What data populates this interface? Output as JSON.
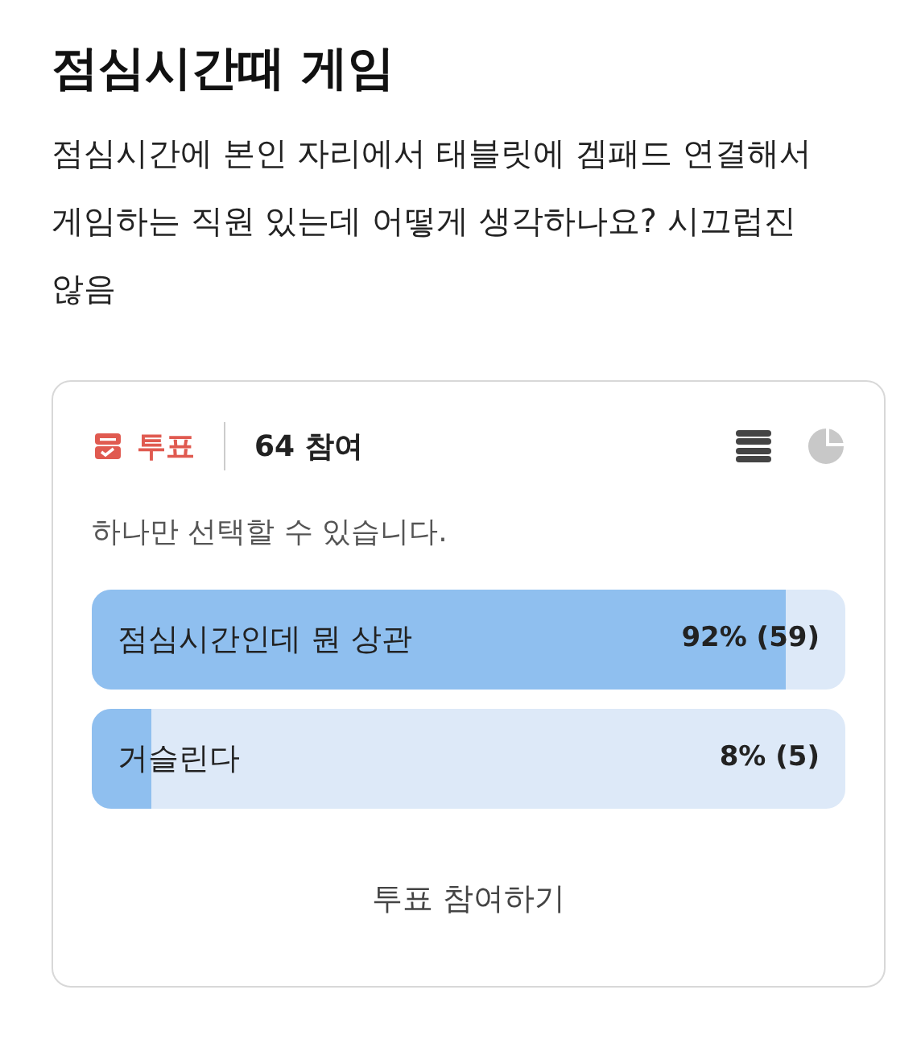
{
  "post": {
    "title": "점심시간때 게임",
    "body": "점심시간에 본인 자리에서 태블릿에 겜패드 연결해서 게임하는 직원 있는데 어떻게 생각하나요? 시끄럽진 않음"
  },
  "poll": {
    "label": "투표",
    "participants": "64 참여",
    "views": [
      {
        "kind": "bars",
        "selected": true
      },
      {
        "kind": "pie",
        "selected": false
      }
    ],
    "note": "하나만 선택할 수 있습니다.",
    "options": [
      {
        "text": "점심시간인데 뭔 상관",
        "result": "92% (59)",
        "level": 0.92
      },
      {
        "text": "거슬린다",
        "result": "8% (5)",
        "level": 0.08
      }
    ],
    "action": "투표 참여하기"
  }
}
